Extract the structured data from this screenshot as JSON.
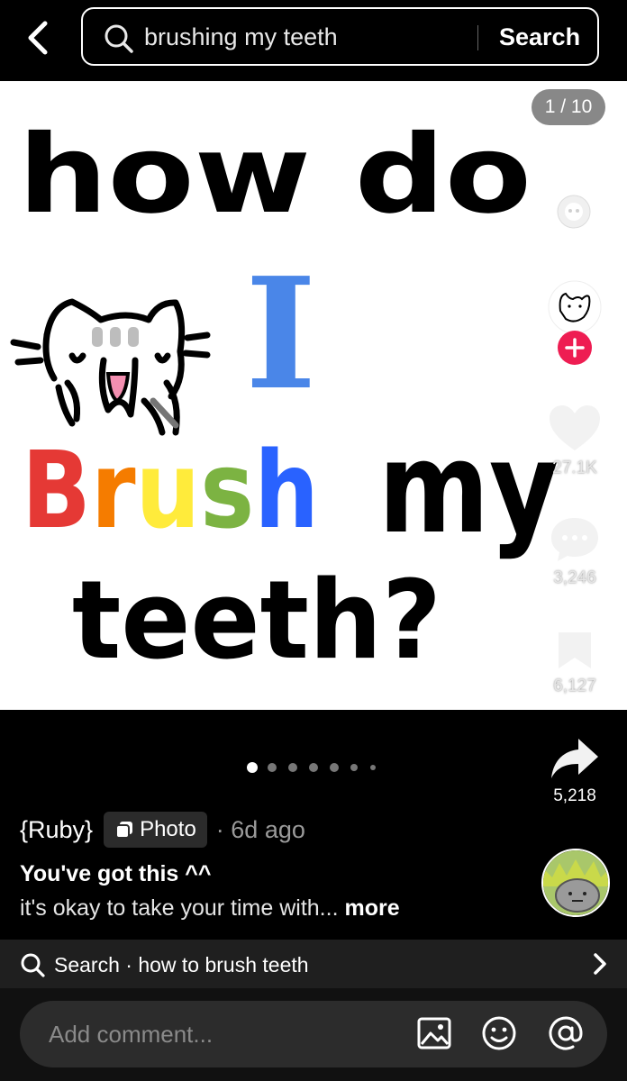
{
  "header": {
    "search_query": "brushing my teeth",
    "search_button": "Search"
  },
  "post": {
    "page_indicator": "1 / 10",
    "artwork_lines": [
      "how do",
      "I",
      "Brush",
      "my",
      "teeth?"
    ],
    "total_pages": 10,
    "current_page": 1,
    "author": "{Ruby}",
    "type_badge": "Photo",
    "time_ago": "· 6d ago",
    "caption_title": "You've got this ^^",
    "caption_text": "it's okay to take your time with...",
    "caption_more": "more"
  },
  "actions": {
    "likes": "27.1K",
    "comments": "3,246",
    "saves": "6,127",
    "shares": "5,218"
  },
  "related_search": {
    "label": "Search · how to brush teeth"
  },
  "comment_bar": {
    "placeholder": "Add comment..."
  },
  "colors": {
    "follow_plus": "#ee1d52",
    "pen_blue": "#4a86e8",
    "dot_active": "#ffffff",
    "dot_inactive": "#777777"
  },
  "icons": [
    "back-arrow-icon",
    "search-icon",
    "photo-badge-icon",
    "heart-icon",
    "comment-icon",
    "bookmark-icon",
    "share-icon",
    "chevron-right-icon",
    "image-icon",
    "emoji-icon",
    "mention-icon"
  ]
}
